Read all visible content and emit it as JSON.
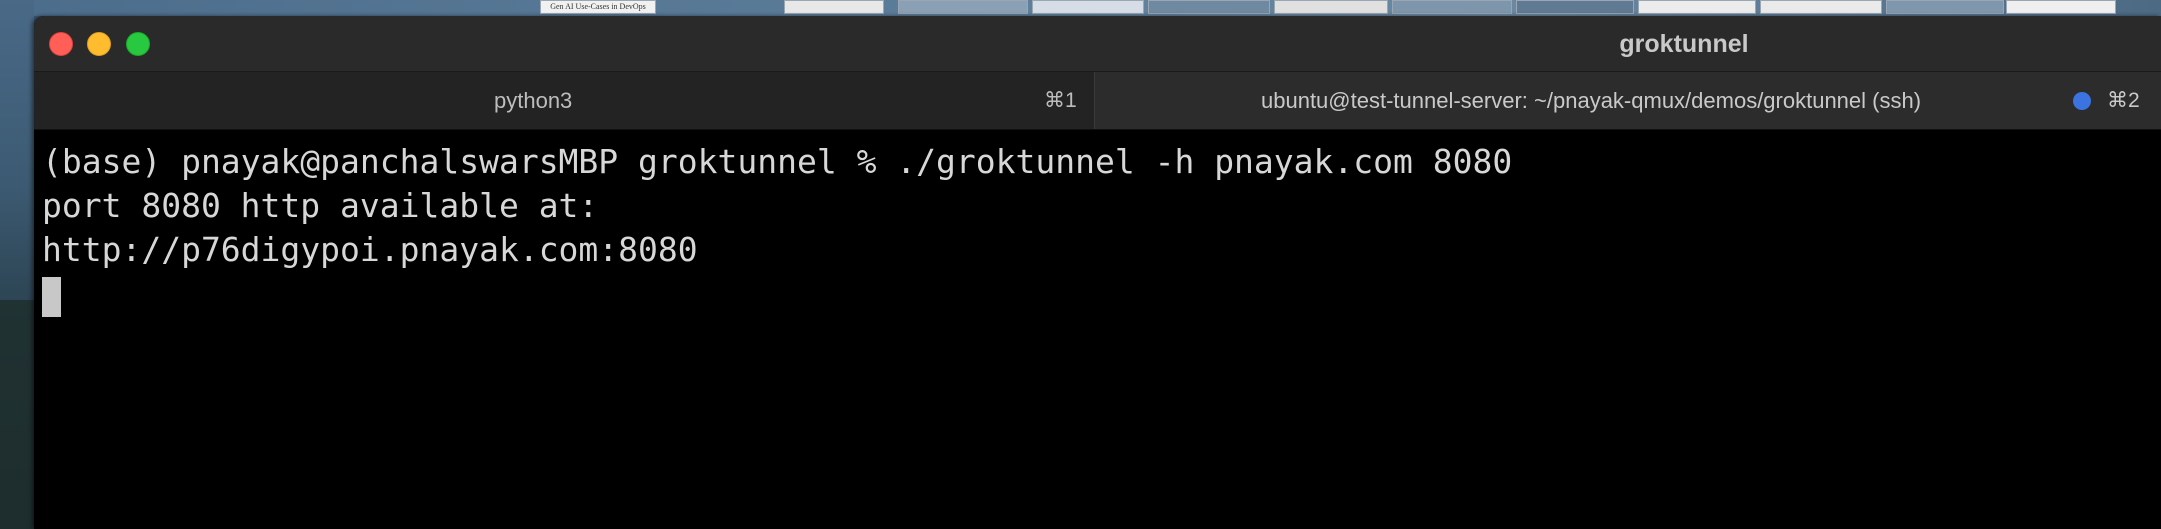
{
  "desktop": {
    "thumbnail_text": "Gen AI Use-Cases in DevOps"
  },
  "window": {
    "title": "groktunnel",
    "traffic_lights": [
      "close-icon",
      "minimize-icon",
      "maximize-icon"
    ]
  },
  "tabs": [
    {
      "label": "python3",
      "shortcut": "⌘1",
      "active": false
    },
    {
      "label": "ubuntu@test-tunnel-server: ~/pnayak-qmux/demos/groktunnel (ssh)",
      "shortcut": "⌘2",
      "active": true,
      "activity_indicator_color": "#3b74e0"
    }
  ],
  "terminal": {
    "lines": [
      "(base) pnayak@panchalswarsMBP groktunnel % ./groktunnel -h pnayak.com 8080",
      "port 8080 http available at:",
      "http://p76digypoi.pnayak.com:8080"
    ],
    "text_color": "#d7d7d7",
    "background_color": "#000000"
  }
}
